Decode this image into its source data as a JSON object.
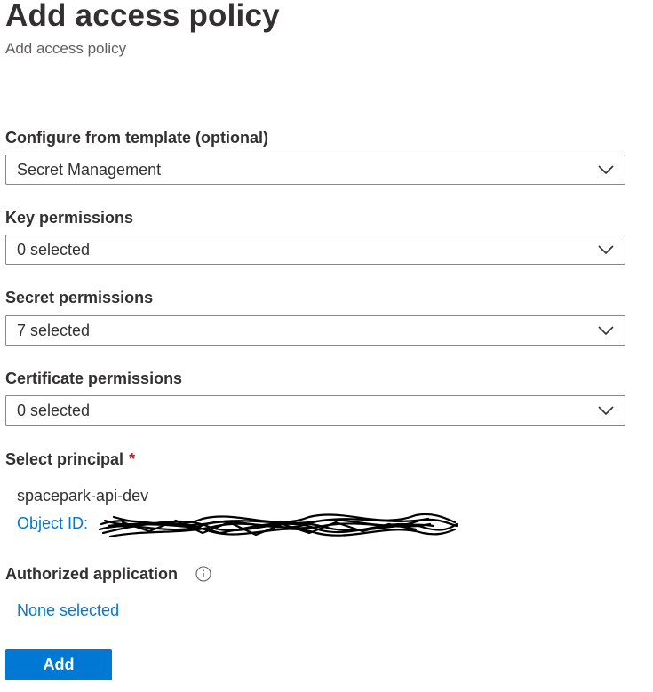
{
  "header": {
    "title": "Add access policy",
    "subtitle": "Add access policy"
  },
  "form": {
    "template": {
      "label": "Configure from template (optional)",
      "value": "Secret Management"
    },
    "key_permissions": {
      "label": "Key permissions",
      "value": "0 selected"
    },
    "secret_permissions": {
      "label": "Secret permissions",
      "value": "7 selected"
    },
    "certificate_permissions": {
      "label": "Certificate permissions",
      "value": "0 selected"
    },
    "principal": {
      "label": "Select principal",
      "required_marker": "*",
      "name": "spacepark-api-dev",
      "object_id_label": "Object ID:"
    },
    "authorized_application": {
      "label": "Authorized application",
      "value": "None selected",
      "info_icon": "info-circle-icon"
    }
  },
  "actions": {
    "add_label": "Add"
  },
  "icons": {
    "dropdown": "chevron-down-icon"
  },
  "colors": {
    "accent": "#0078d4",
    "required": "#a4262c",
    "text": "#323130",
    "subtle_text": "#605e5c",
    "border": "#8a8886"
  }
}
